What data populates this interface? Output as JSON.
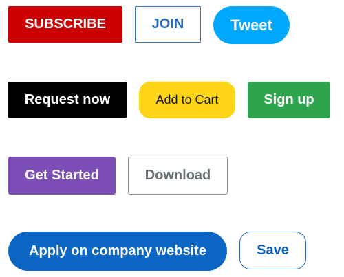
{
  "buttons": {
    "subscribe": "SUBSCRIBE",
    "join": "JOIN",
    "tweet": "Tweet",
    "request_now": "Request now",
    "add_to_cart": "Add to Cart",
    "sign_up": "Sign up",
    "get_started": "Get Started",
    "download": "Download",
    "apply": "Apply on company website",
    "save": "Save"
  },
  "colors": {
    "subscribe_bg": "#cc0000",
    "join_border": "#3a74c4",
    "tweet_bg": "#00a8ff",
    "request_bg": "#000000",
    "cart_bg": "#ffd517",
    "signup_bg": "#2ea44f",
    "getstarted_bg": "#7d4fb6",
    "download_border": "#8a8f96",
    "apply_bg": "#0a66c2",
    "save_border": "#1f66bd"
  }
}
